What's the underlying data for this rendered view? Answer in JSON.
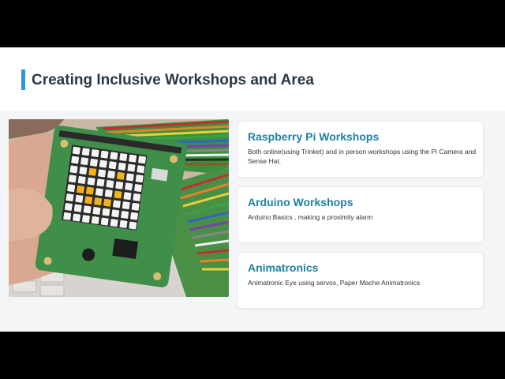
{
  "slide": {
    "title": "Creating Inclusive Workshops and Area"
  },
  "cards": [
    {
      "title": "Raspberry Pi Workshops",
      "text": "Both online(using Trinket) and in person workshops using the Pi Camera and Sense Hat."
    },
    {
      "title": "Arduino Workshops",
      "text": "Arduino Basics , making a proximity alarm"
    },
    {
      "title": "Animatronics",
      "text": "Animatronic Eye using servos, Paper Mache Animatronics"
    }
  ],
  "colors": {
    "accent": "#2a9ad6",
    "card_title": "#1f7fa6",
    "title_text": "#2b3742",
    "band": "#f4f5f6"
  }
}
